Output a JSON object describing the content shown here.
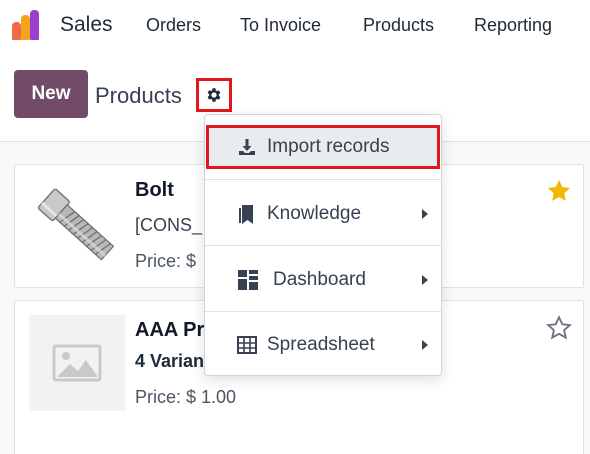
{
  "nav": {
    "app_name": "Sales",
    "items": [
      "Orders",
      "To Invoice",
      "Products",
      "Reporting"
    ]
  },
  "control_panel": {
    "new_label": "New",
    "breadcrumb": "Products"
  },
  "dropdown": {
    "items": [
      {
        "label": "Import records",
        "icon": "download-icon"
      },
      {
        "label": "Knowledge",
        "icon": "bookmark-icon"
      },
      {
        "label": "Dashboard",
        "icon": "dashboard-icon"
      },
      {
        "label": "Spreadsheet",
        "icon": "table-icon"
      }
    ]
  },
  "cards": [
    {
      "title": "Bolt",
      "subtitle": "[CONS_",
      "price": "Price: $",
      "favorite": true
    },
    {
      "title": "AAA Pr",
      "subtitle": "4 Varian",
      "price": "Price: $ 1.00",
      "favorite": false
    }
  ],
  "colors": {
    "brand": "#714b67",
    "highlight": "#e0171c",
    "star": "#f3b800"
  }
}
